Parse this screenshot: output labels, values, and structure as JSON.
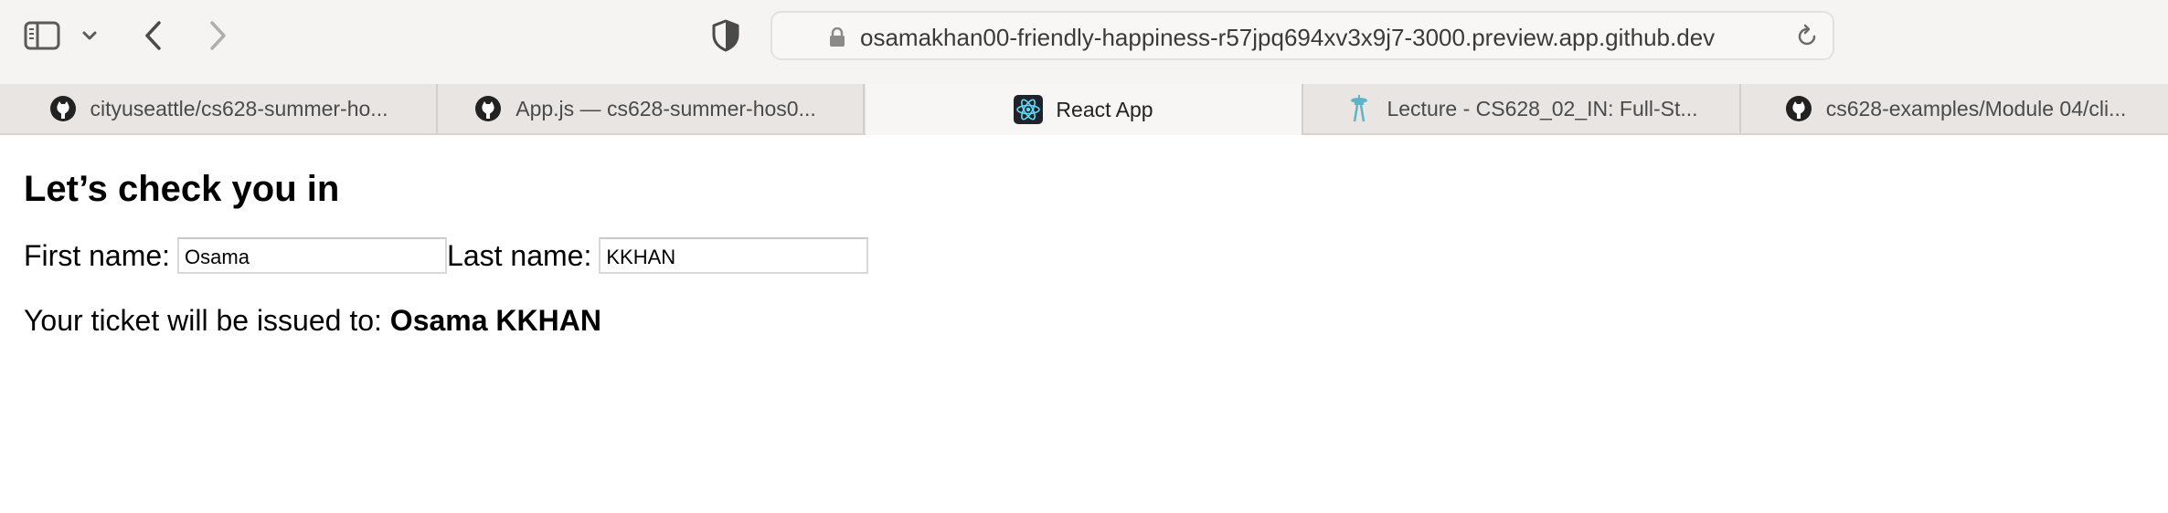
{
  "browser": {
    "url": "osamakhan00-friendly-happiness-r57jpq694xv3x9j7-3000.preview.app.github.dev",
    "icons": {
      "sidebar": "sidebar-icon",
      "chevron": "chevron-down-icon",
      "back": "back-arrow-icon",
      "forward": "forward-arrow-icon",
      "privacy": "shield-icon",
      "lock": "lock-icon",
      "reload": "reload-icon"
    }
  },
  "tabs": [
    {
      "label": "cityuseattle/cs628-summer-ho...",
      "icon": "github-icon",
      "active": false
    },
    {
      "label": "App.js — cs628-summer-hos0...",
      "icon": "github-icon",
      "active": false
    },
    {
      "label": "React App",
      "icon": "react-icon",
      "active": true
    },
    {
      "label": "Lecture - CS628_02_IN: Full-St...",
      "icon": "space-needle-icon",
      "active": false
    },
    {
      "label": "cs628-examples/Module 04/cli...",
      "icon": "github-icon",
      "active": false
    }
  ],
  "page": {
    "title": "Let’s check you in",
    "first_name_label": "First name:",
    "first_name_value": "Osama",
    "last_name_label": "Last name:",
    "last_name_value": "KKHAN",
    "ticket_prefix": "Your ticket will be issued to: ",
    "ticket_name": "Osama KKHAN"
  },
  "colors": {
    "toolbar_bg": "#f6f4f3",
    "tabbar_bg": "#e8e5e3",
    "active_tab_bg": "#f8f6f5",
    "react_blue": "#61dafb"
  }
}
